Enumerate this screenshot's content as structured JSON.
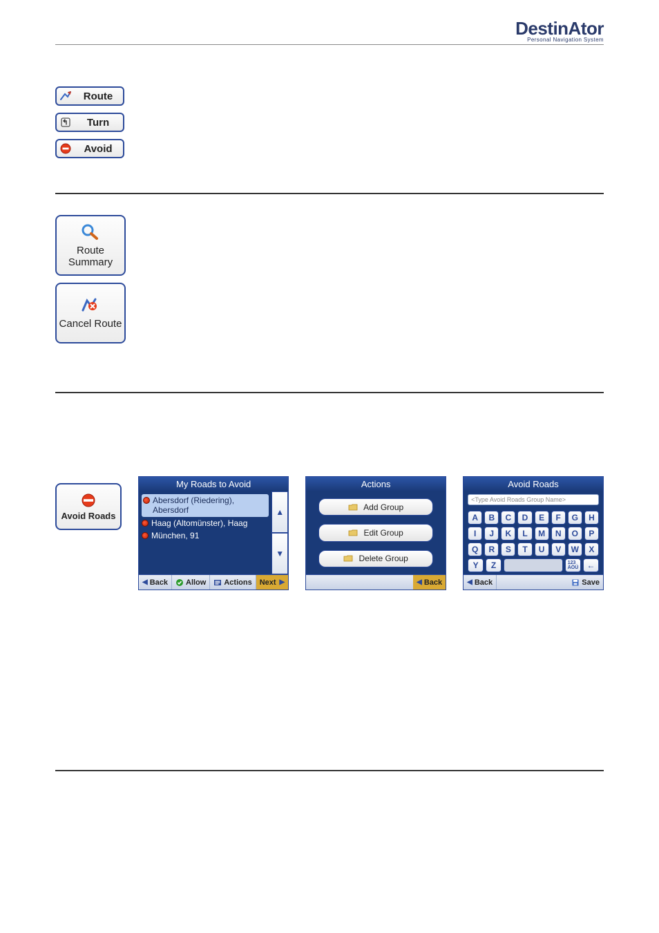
{
  "brand": {
    "name": "DestinAtor",
    "tagline": "Personal Navigation System"
  },
  "mini_buttons": {
    "route": "Route",
    "turn": "Turn",
    "avoid": "Avoid"
  },
  "option_buttons": {
    "route_summary": "Route\nSummary",
    "cancel_route": "Cancel Route",
    "avoid_roads": "Avoid Roads"
  },
  "panel_roads": {
    "title": "My Roads to Avoid",
    "items": [
      {
        "label": "Abersdorf (Riedering), Abersdorf",
        "selected": true
      },
      {
        "label": "Haag (Altomünster), Haag",
        "selected": false
      },
      {
        "label": "München, 91",
        "selected": false
      }
    ],
    "footer": {
      "back": "Back",
      "allow": "Allow",
      "actions": "Actions",
      "next": "Next"
    }
  },
  "panel_actions": {
    "title": "Actions",
    "items": {
      "add": "Add Group",
      "edit": "Edit Group",
      "delete": "Delete Group"
    },
    "footer": {
      "back": "Back"
    }
  },
  "panel_keyboard": {
    "title": "Avoid Roads",
    "placeholder": "<Type Avoid Roads Group Name>",
    "rows": [
      [
        "A",
        "B",
        "C",
        "D",
        "E",
        "F",
        "G",
        "H"
      ],
      [
        "I",
        "J",
        "K",
        "L",
        "M",
        "N",
        "O",
        "P"
      ],
      [
        "Q",
        "R",
        "S",
        "T",
        "U",
        "V",
        "W",
        "X"
      ],
      [
        "Y",
        "Z",
        "",
        "",
        "",
        "",
        "123\nÄÖÜ",
        "←"
      ]
    ],
    "footer": {
      "back": "Back",
      "save": "Save"
    }
  }
}
